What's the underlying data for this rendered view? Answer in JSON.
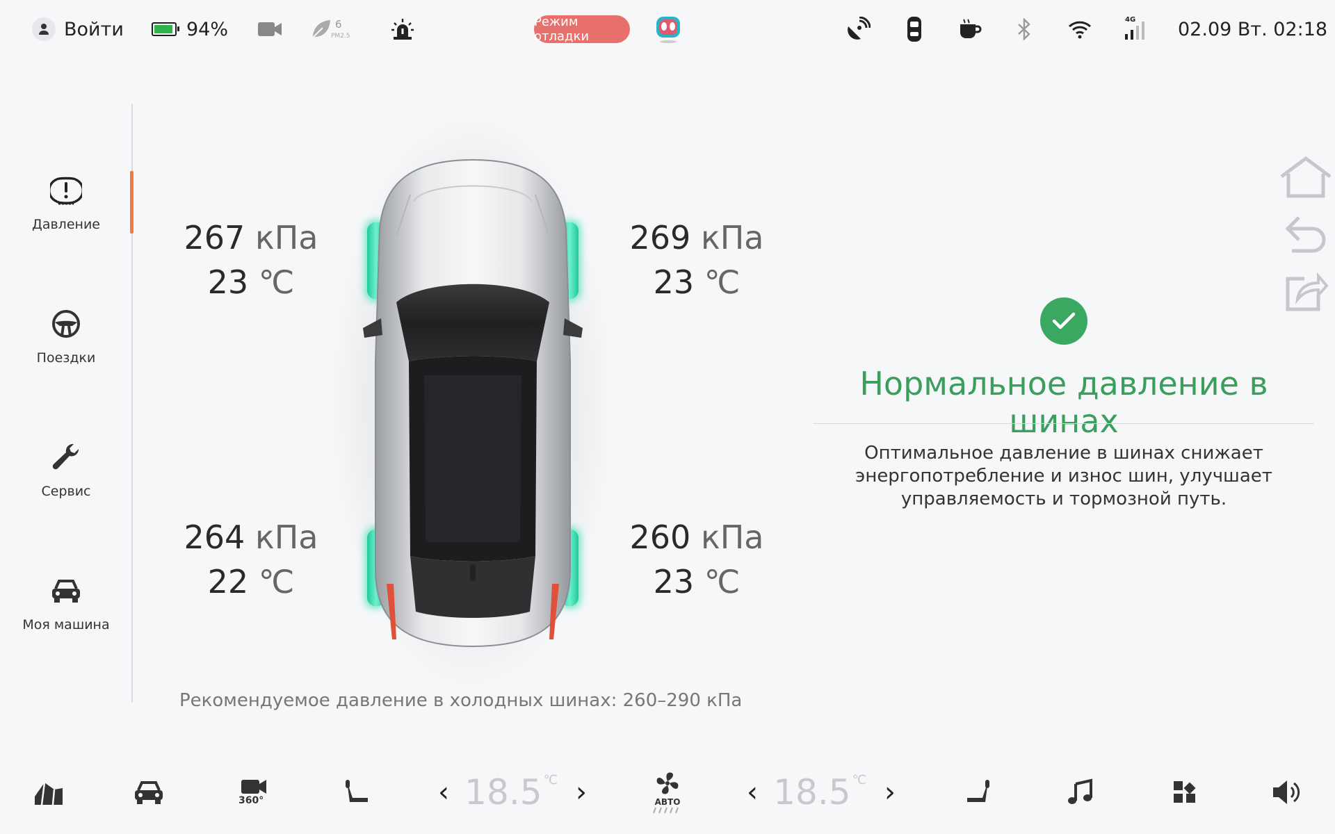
{
  "statusbar": {
    "login_label": "Войти",
    "battery_percent": "94%",
    "battery_level": 0.94,
    "pm_value": "6",
    "pm_label": "PM2.5",
    "debug_mode": "Режим отладки",
    "datetime": "02.09 Вт. 02:18",
    "network_label": "4G"
  },
  "sidebar": {
    "items": [
      {
        "label": "Давление",
        "icon": "tire-pressure-icon",
        "active": true
      },
      {
        "label": "Поездки",
        "icon": "steering-wheel-icon",
        "active": false
      },
      {
        "label": "Сервис",
        "icon": "wrench-icon",
        "active": false
      },
      {
        "label": "Моя машина",
        "icon": "car-icon",
        "active": false
      }
    ]
  },
  "tires": {
    "front_left": {
      "pressure": "267",
      "temp": "23"
    },
    "front_right": {
      "pressure": "269",
      "temp": "23"
    },
    "rear_left": {
      "pressure": "264",
      "temp": "22"
    },
    "rear_right": {
      "pressure": "260",
      "temp": "23"
    },
    "pressure_unit": "кПа",
    "temp_unit": "℃"
  },
  "recommendation": "Рекомендуемое давление в холодных шинах: 260–290 кПа",
  "status": {
    "title": "Нормальное давление в шинах",
    "description": "Оптимальное давление в шинах снижает энергопотребление и износ шин, улучшает управляемость и тормозной путь.",
    "color": "#3aa860"
  },
  "dock": {
    "left_temp": "18.5",
    "right_temp": "18.5",
    "temp_unit": "℃",
    "fan_mode": "АВТО",
    "camera_label": "360°"
  },
  "colors": {
    "accent": "#f07b3f",
    "tire_glow": "#2ee0b0",
    "debug_badge": "#e8706c"
  }
}
